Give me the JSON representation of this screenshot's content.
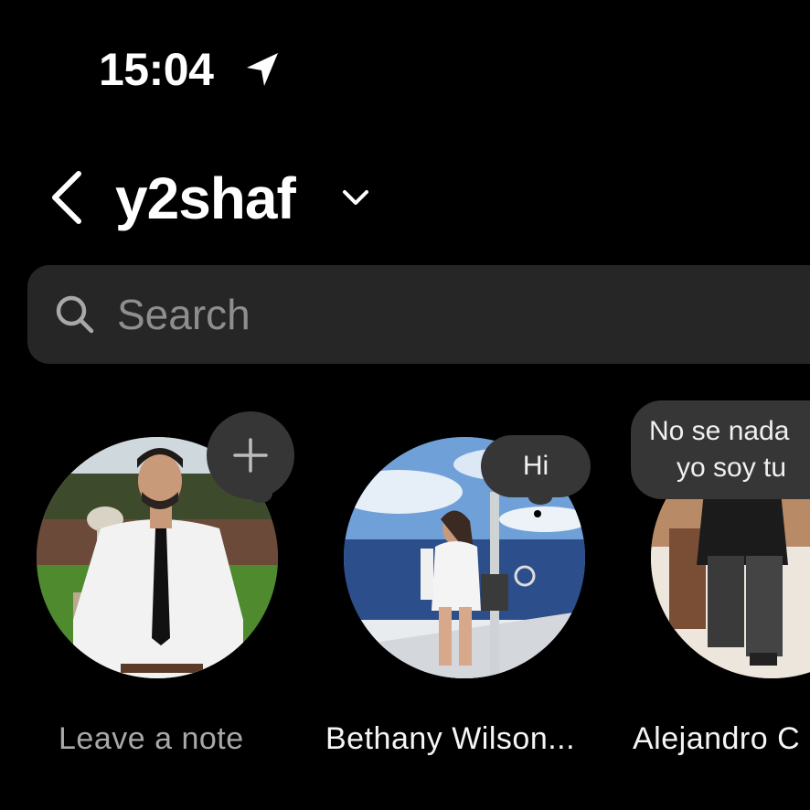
{
  "status_bar": {
    "time": "15:04",
    "location_icon": "location-arrow-icon"
  },
  "header": {
    "back_icon": "chevron-left-icon",
    "account_name": "y2shaf",
    "switch_icon": "chevron-down-icon"
  },
  "search": {
    "placeholder": "Search",
    "icon": "search-icon"
  },
  "notes": [
    {
      "label": "Leave a note",
      "bubble_icon": "plus-icon",
      "own": true
    },
    {
      "label": "Bethany Wilson...",
      "note_text": "Hi"
    },
    {
      "label": "Alejandro C",
      "note_text_line1": "No se nada",
      "note_text_line2": "yo soy tu"
    }
  ],
  "colors": {
    "background": "#000000",
    "search_bg": "#262626",
    "bubble_bg": "#363636",
    "muted_text": "#a8a8a8",
    "placeholder_text": "#8e8e8e"
  }
}
